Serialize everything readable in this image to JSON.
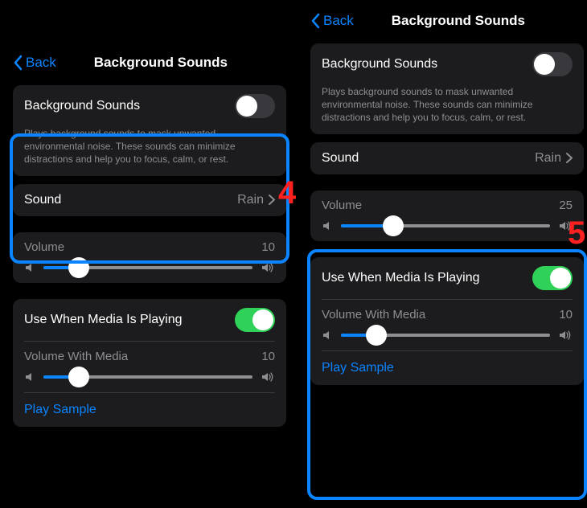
{
  "left": {
    "nav": {
      "back": "Back",
      "title": "Background Sounds"
    },
    "bg_row_label": "Background Sounds",
    "bg_toggle_on": false,
    "desc": "Plays background sounds to mask unwanted environmental noise. These sounds can minimize distractions and help you to focus, calm, or rest.",
    "sound_label": "Sound",
    "sound_value": "Rain",
    "volume_label": "Volume",
    "volume_value": "10",
    "volume_percent": 17,
    "use_media_label": "Use When Media Is Playing",
    "use_media_on": true,
    "vwm_label": "Volume With Media",
    "vwm_value": "10",
    "vwm_percent": 17,
    "play_sample": "Play Sample",
    "annotation": "4"
  },
  "right": {
    "nav": {
      "back": "Back",
      "title": "Background Sounds"
    },
    "bg_row_label": "Background Sounds",
    "bg_toggle_on": false,
    "desc": "Plays background sounds to mask unwanted environmental noise. These sounds can minimize distractions and help you to focus, calm, or rest.",
    "sound_label": "Sound",
    "sound_value": "Rain",
    "volume_label": "Volume",
    "volume_value": "25",
    "volume_percent": 25,
    "use_media_label": "Use When Media Is Playing",
    "use_media_on": true,
    "vwm_label": "Volume With Media",
    "vwm_value": "10",
    "vwm_percent": 17,
    "play_sample": "Play Sample",
    "annotation": "5"
  }
}
